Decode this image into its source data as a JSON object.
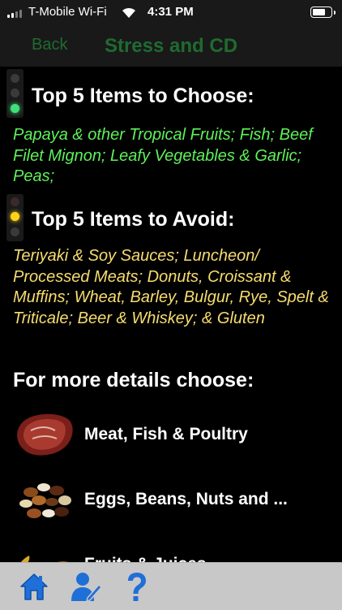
{
  "status_bar": {
    "carrier": "T-Mobile Wi-Fi",
    "time": "4:31 PM",
    "battery_level": 0.75
  },
  "nav": {
    "back_label": "Back",
    "title": "Stress and CD",
    "accent_color": "#1f6b2f"
  },
  "choose": {
    "heading": "Top 5 Items to Choose:",
    "text": "Papaya & other Tropical Fruits; Fish; Beef Filet Mignon; Leafy Vegetables & Garlic; Peas;",
    "color": "#5ff05a",
    "icon": "traffic-light-green-icon"
  },
  "avoid": {
    "heading": "Top 5 Items to Avoid:",
    "text": "Teriyaki & Soy Sauces; Luncheon/ Processed Meats; Donuts, Croissant & Muffins; Wheat, Barley, Bulgur, Rye, Spelt & Triticale; Beer & Whiskey; & Gluten",
    "color": "#f7dc6f",
    "icon": "traffic-light-yellow-icon"
  },
  "more": {
    "heading": "For more details choose:"
  },
  "categories": [
    {
      "label": "Meat, Fish & Poultry",
      "icon": "steak-icon"
    },
    {
      "label": "Eggs, Beans, Nuts and ...",
      "icon": "beans-icon"
    },
    {
      "label": "Fruits & Juices",
      "icon": "banana-icon"
    }
  ],
  "tab_bar": {
    "items": [
      "home-icon",
      "user-edit-icon",
      "help-icon"
    ]
  }
}
